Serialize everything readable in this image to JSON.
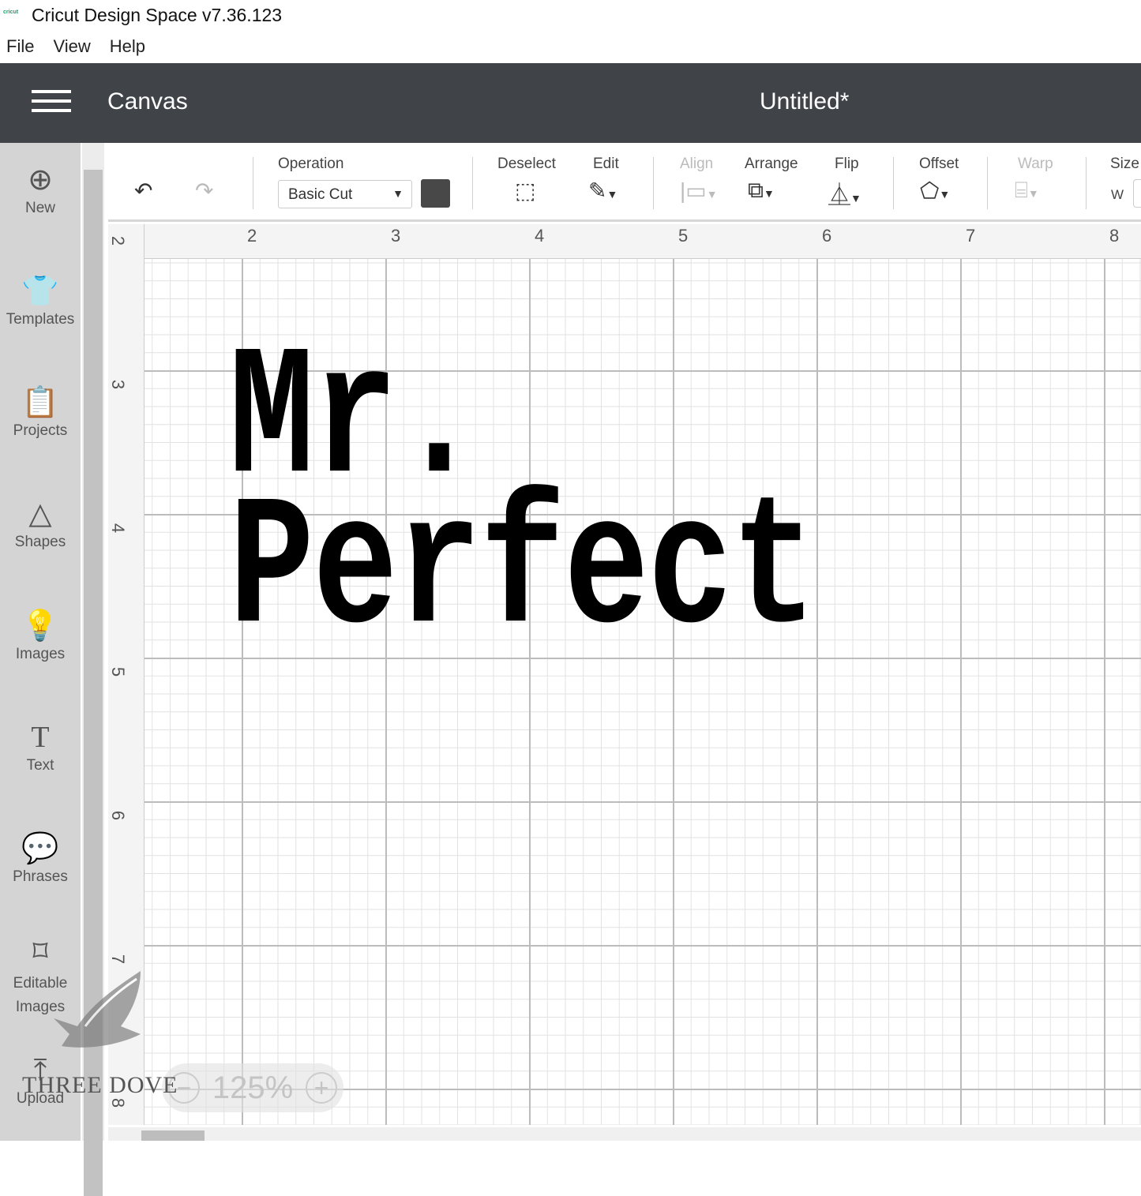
{
  "window": {
    "logo": "cricut",
    "title": "Cricut Design Space  v7.36.123"
  },
  "menu": [
    "File",
    "View",
    "Help"
  ],
  "header": {
    "section": "Canvas",
    "document": "Untitled*"
  },
  "sidebar": [
    {
      "label": "New",
      "icon": "plus-circle-icon"
    },
    {
      "label": "Templates",
      "icon": "shirt-icon"
    },
    {
      "label": "Projects",
      "icon": "clipboard-icon"
    },
    {
      "label": "Shapes",
      "icon": "shapes-icon"
    },
    {
      "label": "Images",
      "icon": "lightbulb-icon"
    },
    {
      "label": "Text",
      "icon": "text-icon"
    },
    {
      "label": "Phrases",
      "icon": "speech-bubble-icon"
    },
    {
      "label": "Editable Images",
      "icon": "editable-image-icon"
    },
    {
      "label": "Upload",
      "icon": "upload-icon"
    }
  ],
  "toolbar": {
    "operation_label": "Operation",
    "operation_value": "Basic Cut",
    "operation_color": "#484848",
    "deselect": "Deselect",
    "edit": "Edit",
    "align": "Align",
    "arrange": "Arrange",
    "flip": "Flip",
    "offset": "Offset",
    "warp": "Warp",
    "size": "Size",
    "size_w": "W"
  },
  "rulers": {
    "horizontal": [
      "2",
      "3",
      "4",
      "5",
      "6",
      "7",
      "8"
    ],
    "vertical": [
      "2",
      "3",
      "4",
      "5",
      "6",
      "7",
      "8"
    ]
  },
  "canvas": {
    "line1": "Mr.",
    "line2": "Perfect"
  },
  "zoom": {
    "minus": "−",
    "value": "125%",
    "plus": "+"
  },
  "watermark": {
    "text": "THREE DOVE"
  }
}
